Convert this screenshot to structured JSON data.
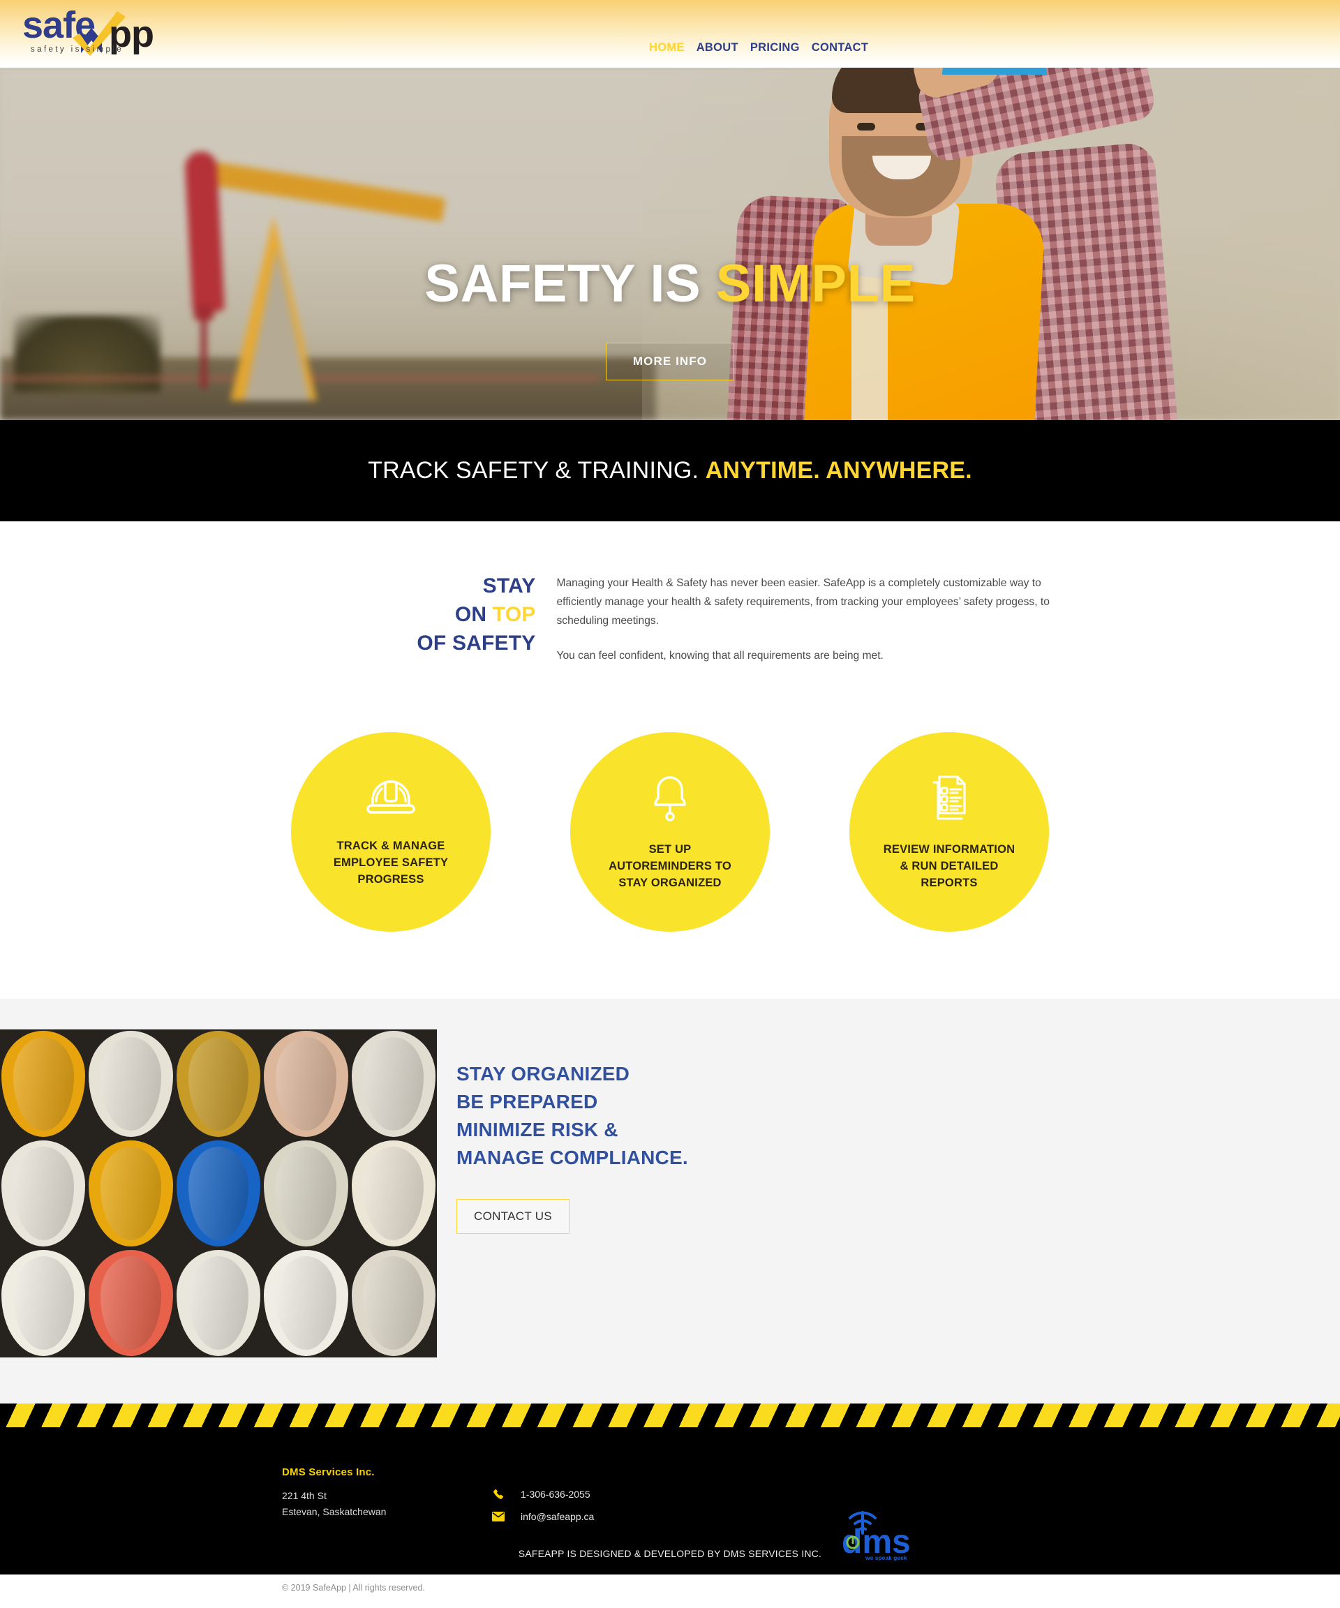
{
  "brand": {
    "logo_word_1": "safe",
    "logo_word_2": "pp",
    "logo_tagline": "safety is simple",
    "accent_yellow": "#ffd633",
    "accent_blue": "#2d3f86",
    "circle_yellow": "#fae32b"
  },
  "nav": {
    "items": [
      {
        "label": "HOME",
        "active": true
      },
      {
        "label": "ABOUT",
        "active": false
      },
      {
        "label": "PRICING",
        "active": false
      },
      {
        "label": "CONTACT",
        "active": false
      }
    ]
  },
  "hero": {
    "title_white": "SAFETY IS",
    "title_yellow": "SIMPLE",
    "button": "MORE INFO"
  },
  "banner": {
    "light": "TRACK SAFETY & TRAINING.",
    "bold": "ANYTIME. ANYWHERE."
  },
  "intro": {
    "heading_line1": "STAY",
    "heading_line2_a": "ON ",
    "heading_line2_b": "TOP",
    "heading_line3": "OF SAFETY",
    "paragraph1": "Managing your Health & Safety has never been easier. SafeApp is a completely customizable way to efficiently manage your health & safety requirements, from tracking your employees’ safety progess, to scheduling meetings.",
    "paragraph2": "You can feel confident, knowing that all requirements are being met."
  },
  "features": [
    {
      "icon": "hard-hat-icon",
      "caption": "TRACK & MANAGE\nEMPLOYEE SAFETY\nPROGRESS"
    },
    {
      "icon": "bell-icon",
      "caption": "SET UP\nAUTOREMINDERS TO\nSTAY ORGANIZED"
    },
    {
      "icon": "checklist-icon",
      "caption": "REVIEW INFORMATION\n& RUN DETAILED\nREPORTS"
    }
  ],
  "organized": {
    "line1": "STAY ORGANIZED",
    "line2": "BE PREPARED",
    "line3": "MINIMIZE RISK &",
    "line4": "MANAGE COMPLIANCE.",
    "button": "CONTACT US",
    "image_alt": "hard-hats-grid"
  },
  "footer": {
    "company": "DMS Services Inc.",
    "address_line1": "221 4th St",
    "address_line2": "Estevan, Saskatchewan",
    "phone": "1-306-636-2055",
    "email": "info@safeapp.ca",
    "credit": "SAFEAPP IS DESIGNED & DEVELOPED BY DMS SERVICES INC.",
    "copyright": "© 2019 SafeApp | All rights reserved.",
    "dms_word": "dms",
    "dms_tagline": "we speak geek"
  }
}
